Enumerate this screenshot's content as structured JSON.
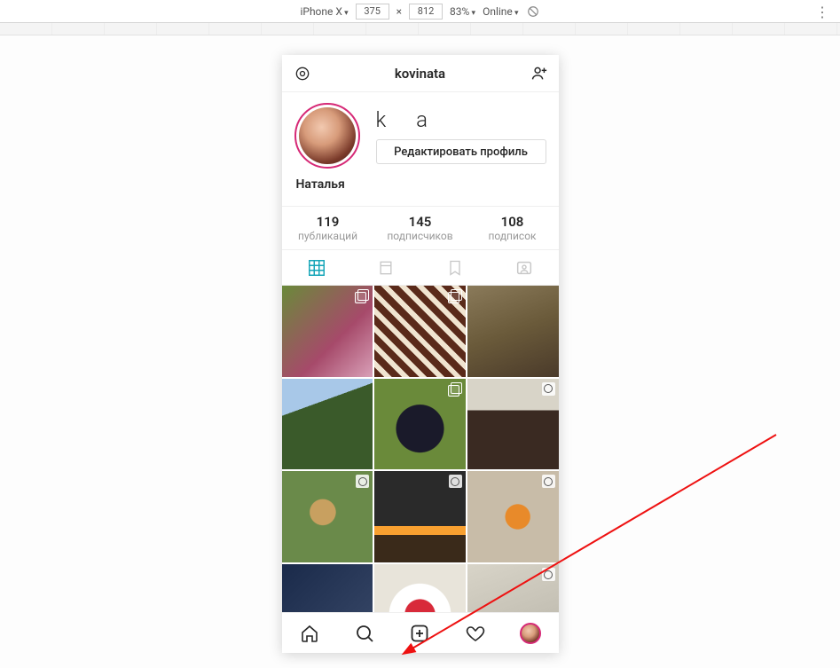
{
  "devtools": {
    "device": "iPhone X",
    "width": "375",
    "height": "812",
    "zoom": "83%",
    "network": "Online"
  },
  "header": {
    "username": "kovinata"
  },
  "profile": {
    "username_display": "k       a",
    "edit_button": "Редактировать профиль",
    "display_name": "Наталья"
  },
  "stats": {
    "posts": {
      "count": "119",
      "label": "публикаций"
    },
    "followers": {
      "count": "145",
      "label": "подписчиков"
    },
    "following": {
      "count": "108",
      "label": "подписок"
    }
  },
  "posts": [
    {
      "badge": "stack"
    },
    {
      "badge": "stack"
    },
    {
      "badge": ""
    },
    {
      "badge": ""
    },
    {
      "badge": "stack"
    },
    {
      "badge": "cam"
    },
    {
      "badge": "cam"
    },
    {
      "badge": "cam"
    },
    {
      "badge": "cam"
    },
    {
      "badge": ""
    },
    {
      "badge": ""
    },
    {
      "badge": "cam"
    }
  ]
}
